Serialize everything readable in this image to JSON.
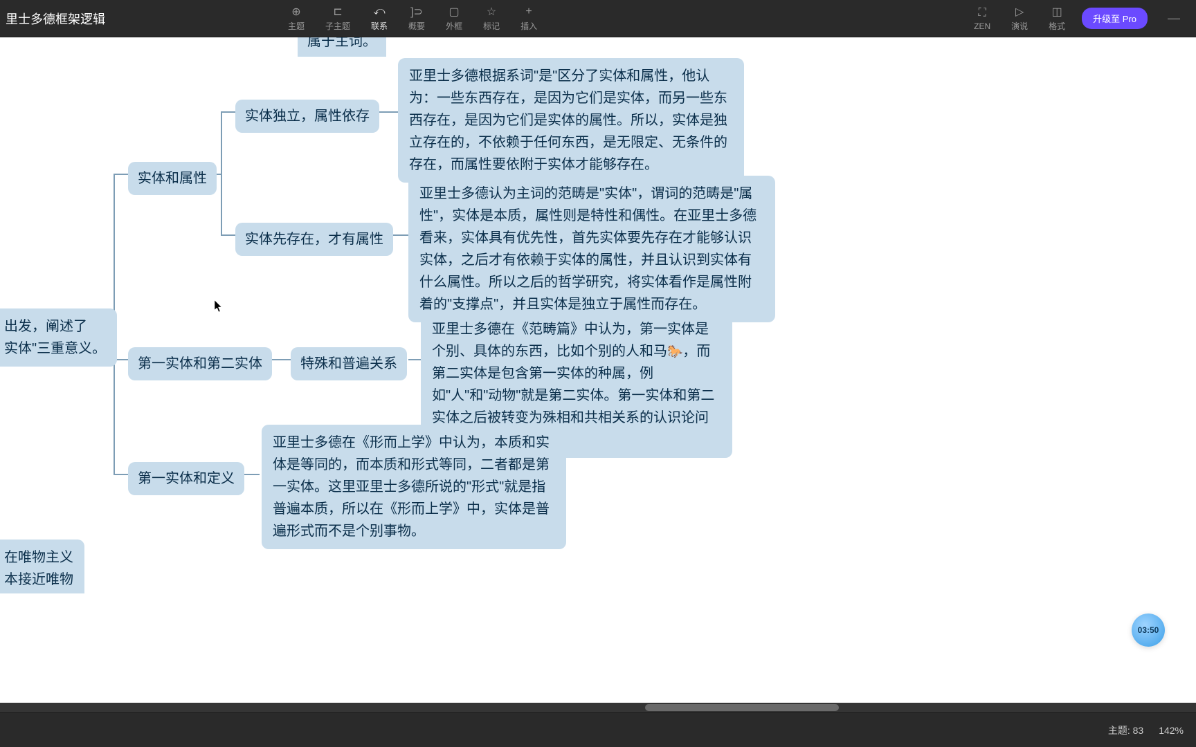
{
  "app": {
    "title": "里士多德框架逻辑"
  },
  "toolbar": {
    "items": [
      {
        "id": "topic",
        "label": "主题",
        "icon": "⊕"
      },
      {
        "id": "subtopic",
        "label": "子主题",
        "icon": "⊏"
      },
      {
        "id": "relate",
        "label": "联系",
        "icon": "⤺"
      },
      {
        "id": "summary",
        "label": "概要",
        "icon": "]⊃"
      },
      {
        "id": "boundary",
        "label": "外框",
        "icon": "▢"
      },
      {
        "id": "mark",
        "label": "标记",
        "icon": "☆"
      },
      {
        "id": "insert",
        "label": "插入",
        "icon": "+"
      }
    ],
    "right_items": [
      {
        "id": "zen",
        "label": "ZEN",
        "icon": "⛶"
      },
      {
        "id": "present",
        "label": "演说",
        "icon": "▷"
      },
      {
        "id": "format",
        "label": "格式",
        "icon": "◫"
      }
    ],
    "upgrade_label": "升级至 Pro"
  },
  "mindmap": {
    "root_partial": "出发，阐述了\n实体\"三重意义。",
    "top_fragment": "属于主词。",
    "branch1": {
      "label": "实体和属性",
      "children": [
        {
          "label": "实体独立，属性依存",
          "detail": "亚里士多德根据系词\"是\"区分了实体和属性，他认为：一些东西存在，是因为它们是实体，而另一些东西存在，是因为它们是实体的属性。所以，实体是独立存在的，不依赖于任何东西，是无限定、无条件的存在，而属性要依附于实体才能够存在。"
        },
        {
          "label": "实体先存在，才有属性",
          "detail": "亚里士多德认为主词的范畴是\"实体\"，谓词的范畴是\"属性\"，实体是本质，属性则是特性和偶性。在亚里士多德看来，实体具有优先性，首先实体要先存在才能够认识实体，之后才有依赖于实体的属性，并且认识到实体有什么属性。所以之后的哲学研究，将实体看作是属性附着的\"支撑点\"，并且实体是独立于属性而存在。"
        }
      ]
    },
    "branch2": {
      "label": "第一实体和第二实体",
      "child": {
        "label": "特殊和普遍关系",
        "detail_before": "亚里士多德在《范畴篇》中认为，第一实体是个别、具体的东西，比如个别的人和马",
        "detail_after": "，而第二实体是包含第一实体的种属，例如\"人\"和\"动物\"就是第二实体。第一实体和第二实体之后被转变为殊相和共相关系的认识论问题。"
      }
    },
    "branch3": {
      "label": "第一实体和定义",
      "detail": "亚里士多德在《形而上学》中认为，本质和实体是等同的，而本质和形式等同，二者都是第一实体。这里亚里士多德所说的\"形式\"就是指普遍本质，所以在《形而上学》中，实体是普遍形式而不是个别事物。"
    },
    "bottom_partial": "在唯物主义\n本接近唯物"
  },
  "timer": "03:50",
  "status": {
    "topic_label": "主题:",
    "topic_count": "83",
    "zoom": "142%"
  }
}
